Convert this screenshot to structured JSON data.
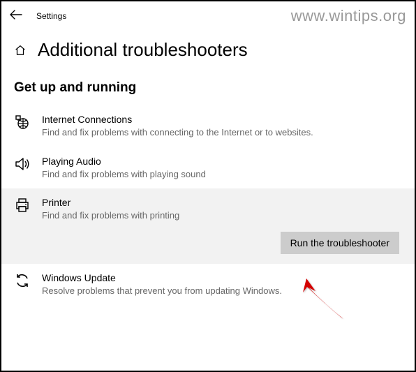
{
  "watermark": "www.wintips.org",
  "app_title": "Settings",
  "page_title": "Additional troubleshooters",
  "section_heading": "Get up and running",
  "run_button_label": "Run the troubleshooter",
  "items": [
    {
      "title": "Internet Connections",
      "desc": "Find and fix problems with connecting to the Internet or to websites."
    },
    {
      "title": "Playing Audio",
      "desc": "Find and fix problems with playing sound"
    },
    {
      "title": "Printer",
      "desc": "Find and fix problems with printing"
    },
    {
      "title": "Windows Update",
      "desc": "Resolve problems that prevent you from updating Windows."
    }
  ]
}
